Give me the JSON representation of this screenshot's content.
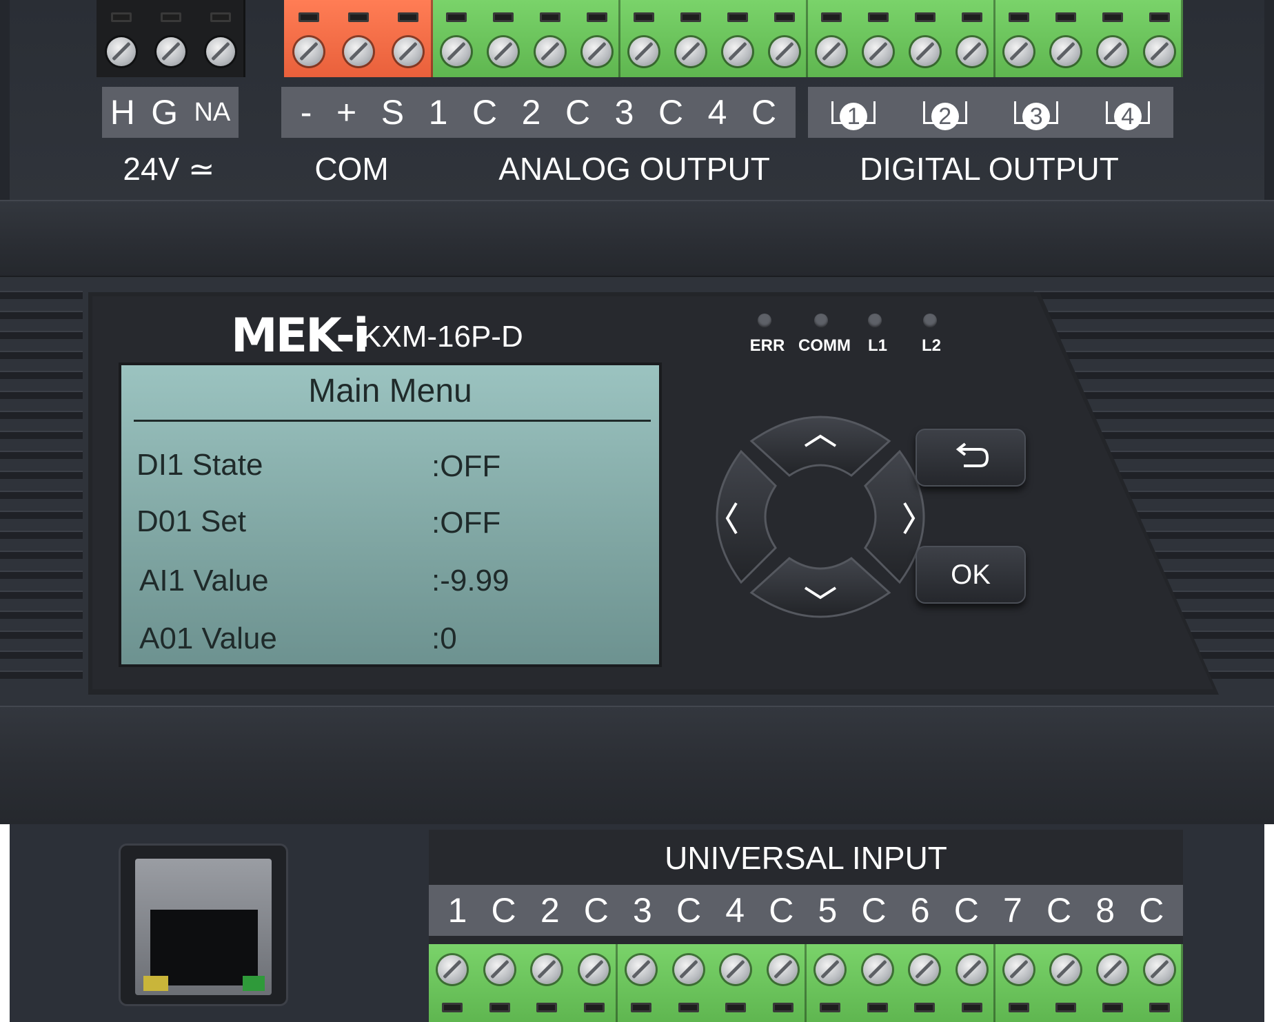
{
  "top_terminals": {
    "power_labels": [
      "H",
      "G",
      "NA"
    ],
    "power_section": "24V ≃",
    "com_section": "COM",
    "analog_labels": [
      "-",
      "+",
      "S",
      "1",
      "C",
      "2",
      "C",
      "3",
      "C",
      "4",
      "C"
    ],
    "analog_section": "ANALOG OUTPUT",
    "digital_labels": [
      "1",
      "2",
      "3",
      "4"
    ],
    "digital_section": "DIGITAL OUTPUT"
  },
  "panel": {
    "brand": "MEK-i",
    "model": "KXM-16P-D",
    "leds": [
      "ERR",
      "COMM",
      "L1",
      "L2"
    ]
  },
  "lcd": {
    "title": "Main Menu",
    "rows": [
      {
        "label": "DI1 State",
        "value": ":OFF"
      },
      {
        "label": "D01 Set",
        "value": ":OFF"
      },
      {
        "label": "AI1 Value",
        "value": ":-9.99"
      },
      {
        "label": "A01 Value",
        "value": ":0"
      }
    ]
  },
  "keypad": {
    "up_icon": "chevron-up-icon",
    "down_icon": "chevron-down-icon",
    "left_icon": "chevron-left-icon",
    "right_icon": "chevron-right-icon",
    "back_icon": "return-arrow-icon",
    "ok_label": "OK"
  },
  "bottom_terminals": {
    "section": "UNIVERSAL INPUT",
    "labels": [
      "1",
      "C",
      "2",
      "C",
      "3",
      "C",
      "4",
      "C",
      "5",
      "C",
      "6",
      "C",
      "7",
      "C",
      "8",
      "C"
    ]
  },
  "colors": {
    "terminal_black": "#1d1e20",
    "terminal_orange": "#f2704a",
    "terminal_green": "#6cc45c",
    "lcd_background": "#8db5b2",
    "housing": "#2f333a"
  }
}
